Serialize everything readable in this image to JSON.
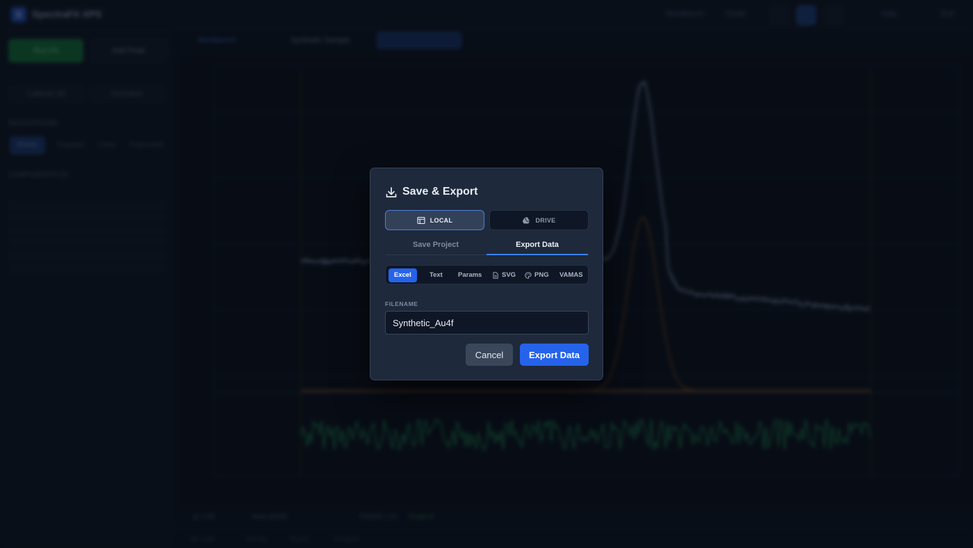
{
  "app": {
    "title": "SpectraFit XPS",
    "logo_letter": "S",
    "top_items": [
      "Workbench",
      "Guide"
    ],
    "top_right": [
      "Help",
      "Exit"
    ]
  },
  "sidebar": {
    "new_button": "Run Fit",
    "add_peak_button": "Add Peak",
    "secondary_buttons": [
      "Calibrate BE",
      "Normalize"
    ],
    "background_heading": "BACKGROUND",
    "background_tabs": [
      "Shirley",
      "Tougaard",
      "Linear",
      "Polynomial"
    ],
    "components_heading": "COMPONENTS (5)"
  },
  "main": {
    "breadcrumb_root": "Workbench",
    "breadcrumb_sample": "Synthetic Sample",
    "status_items": [
      "χ² 1.08",
      "Area 48295",
      "FWHM 1.24",
      "Peaks 5"
    ],
    "footer_items": [
      "BE scale",
      "Overlay",
      "Export",
      "Fit report"
    ]
  },
  "plot": {
    "colors": {
      "data": "#c7d3e6",
      "envelope": "#7fa4de",
      "component": "#c26a1e",
      "residual": "#1f9a55",
      "grid": "#1a2434"
    }
  },
  "modal": {
    "title": "Save & Export",
    "title_icon": "download-icon",
    "destinations": [
      {
        "label": "LOCAL",
        "icon": "window-icon",
        "active": true
      },
      {
        "label": "DRIVE",
        "icon": "drive-icon",
        "active": false
      }
    ],
    "mode_tabs": [
      {
        "label": "Save Project",
        "active": false
      },
      {
        "label": "Export Data",
        "active": true
      }
    ],
    "formats": [
      {
        "label": "Excel",
        "active": true
      },
      {
        "label": "Text",
        "active": false
      },
      {
        "label": "Params",
        "active": false
      },
      {
        "label": "SVG",
        "icon": "file-icon",
        "active": false
      },
      {
        "label": "PNG",
        "icon": "palette-icon",
        "active": false
      },
      {
        "label": "VAMAS",
        "active": false
      }
    ],
    "filename_label": "FILENAME",
    "filename_value": "Synthetic_Au4f",
    "cancel_label": "Cancel",
    "export_label": "Export Data"
  },
  "theme": {
    "accent": "#2563eb",
    "modal_bg": "#1e293b",
    "page_bg": "#0b111c"
  }
}
